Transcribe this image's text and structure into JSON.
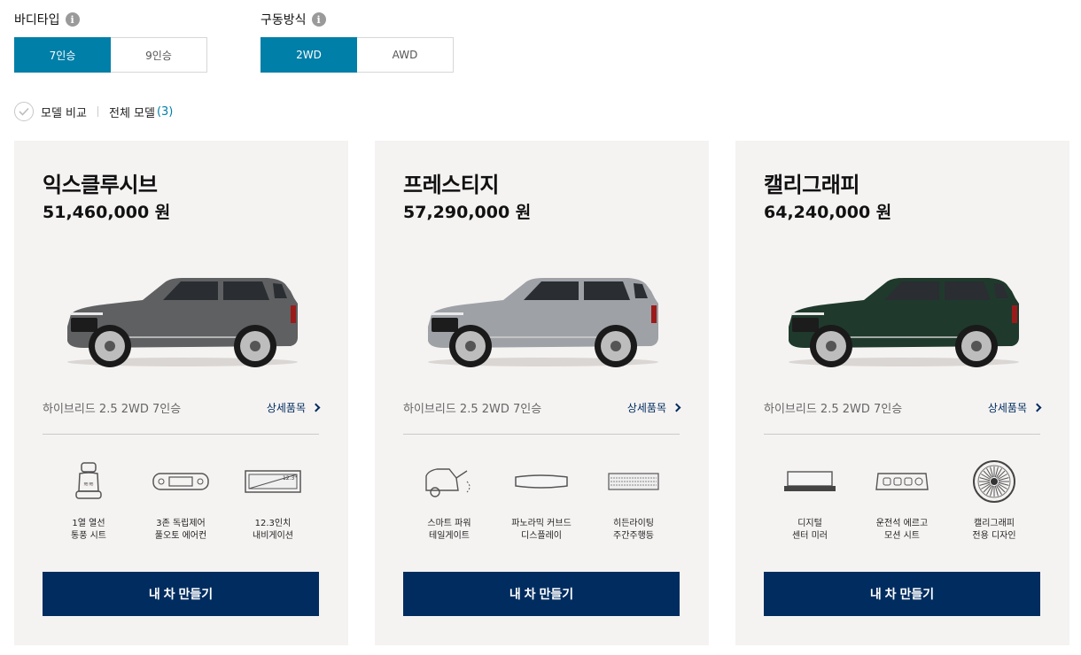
{
  "filters": {
    "body_type": {
      "title": "바디타입",
      "options": [
        "7인승",
        "9인승"
      ],
      "selected": "7인승"
    },
    "drive": {
      "title": "구동방식",
      "options": [
        "2WD",
        "AWD"
      ],
      "selected": "2WD"
    }
  },
  "compare": {
    "label": "모델 비교",
    "all_models_label": "전체 모델",
    "count": "(3)"
  },
  "colors": {
    "accent": "#007fa8",
    "button_navy": "#002c5f",
    "card_bg": "#f5f3f2"
  },
  "cards": [
    {
      "name": "익스클루시브",
      "price": "51,460,000 원",
      "car_color": "#5f6062",
      "spec": "하이브리드 2.5 2WD 7인승",
      "detail_label": "상세품목",
      "features": [
        {
          "icon": "heated-seat-icon",
          "label": "1열 열선\n통풍 시트"
        },
        {
          "icon": "climate-control-icon",
          "label": "3존 독립제어\n풀오토 에어컨"
        },
        {
          "icon": "navigation-screen-icon",
          "label": "12.3인치\n내비게이션",
          "screen_text": "12.3\""
        }
      ],
      "build_label": "내 차 만들기"
    },
    {
      "name": "프레스티지",
      "price": "57,290,000 원",
      "car_color": "#9ea1a6",
      "spec": "하이브리드 2.5 2WD 7인승",
      "detail_label": "상세품목",
      "features": [
        {
          "icon": "power-tailgate-icon",
          "label": "스마트 파워\n테일게이트"
        },
        {
          "icon": "curved-display-icon",
          "label": "파노라믹 커브드\n디스플레이"
        },
        {
          "icon": "hidden-drl-icon",
          "label": "히든라이팅\n주간주행등"
        }
      ],
      "build_label": "내 차 만들기"
    },
    {
      "name": "캘리그래피",
      "price": "64,240,000 원",
      "car_color": "#1f3a2c",
      "spec": "하이브리드 2.5 2WD 7인승",
      "detail_label": "상세품목",
      "features": [
        {
          "icon": "digital-mirror-icon",
          "label": "디지털\n센터 미러"
        },
        {
          "icon": "ergo-seat-control-icon",
          "label": "운전석 에르고\n모션 시트"
        },
        {
          "icon": "calligraphy-wheel-icon",
          "label": "캘리그래피\n전용 디자인"
        }
      ],
      "build_label": "내 차 만들기"
    }
  ]
}
